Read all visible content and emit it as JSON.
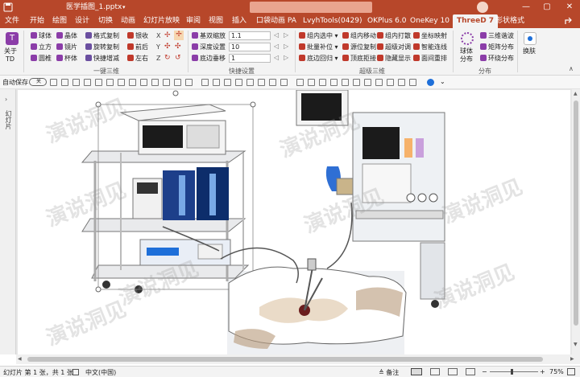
{
  "window": {
    "filename": "医学插图_1.pptx",
    "filename_suffix": "▾",
    "search_placeholder": "",
    "min": "—",
    "max": "▢",
    "close": "✕"
  },
  "tabs": [
    "文件",
    "开始",
    "绘图",
    "设计",
    "切换",
    "动画",
    "幻灯片放映",
    "审阅",
    "视图",
    "插入",
    "口袋动画 PA",
    "LvyhTools(0429)",
    "OKPlus 6.0",
    "OneKey 10",
    "ThreeD 7",
    "形状格式"
  ],
  "active_tab": "ThreeD 7",
  "ribbon": {
    "about": {
      "label1": "关于",
      "label2": "TD"
    },
    "shapes": [
      "球体",
      "立方",
      "圆椎",
      "晶体",
      "镜片",
      "杯体"
    ],
    "paste": [
      "格式复制",
      "旋转复制",
      "快捷增减"
    ],
    "misc": [
      "银收",
      "前后",
      "左右"
    ],
    "group1_label": "一键三维",
    "xyz": [
      "X",
      "Y",
      "Z"
    ],
    "settings": [
      {
        "label": "基双缩放",
        "value": "1.1"
      },
      {
        "label": "深度设置",
        "value": "10"
      },
      {
        "label": "底边垂移",
        "value": "1"
      }
    ],
    "group2_label": "快捷设置",
    "super3d": [
      "组内选中",
      "批量补位",
      "底边回归",
      "组内移动",
      "源位复制",
      "顶底拒接",
      "组内打散",
      "超级对调",
      "隐藏显示",
      "坐标映射",
      "智能连线",
      "面间重排"
    ],
    "group3_label": "超级三维",
    "distribute": {
      "big_label1": "球体",
      "big_label2": "分布",
      "items": [
        "三维谐波",
        "矩阵分布",
        "环绕分布"
      ]
    },
    "group4_label": "分布",
    "skin": "换肤"
  },
  "qat": {
    "autosave": "自动保存",
    "toggle": "关"
  },
  "leftpane": {
    "label": "幻灯片"
  },
  "watermark": "演说洞见",
  "status": {
    "slide": "幻灯片 第 1 张，共 1 张",
    "lang": "中文(中国)",
    "notes": "备注",
    "zoom": "75%"
  },
  "colors": {
    "brand": "#b7472a",
    "ribbon": "#f3f3f3"
  }
}
